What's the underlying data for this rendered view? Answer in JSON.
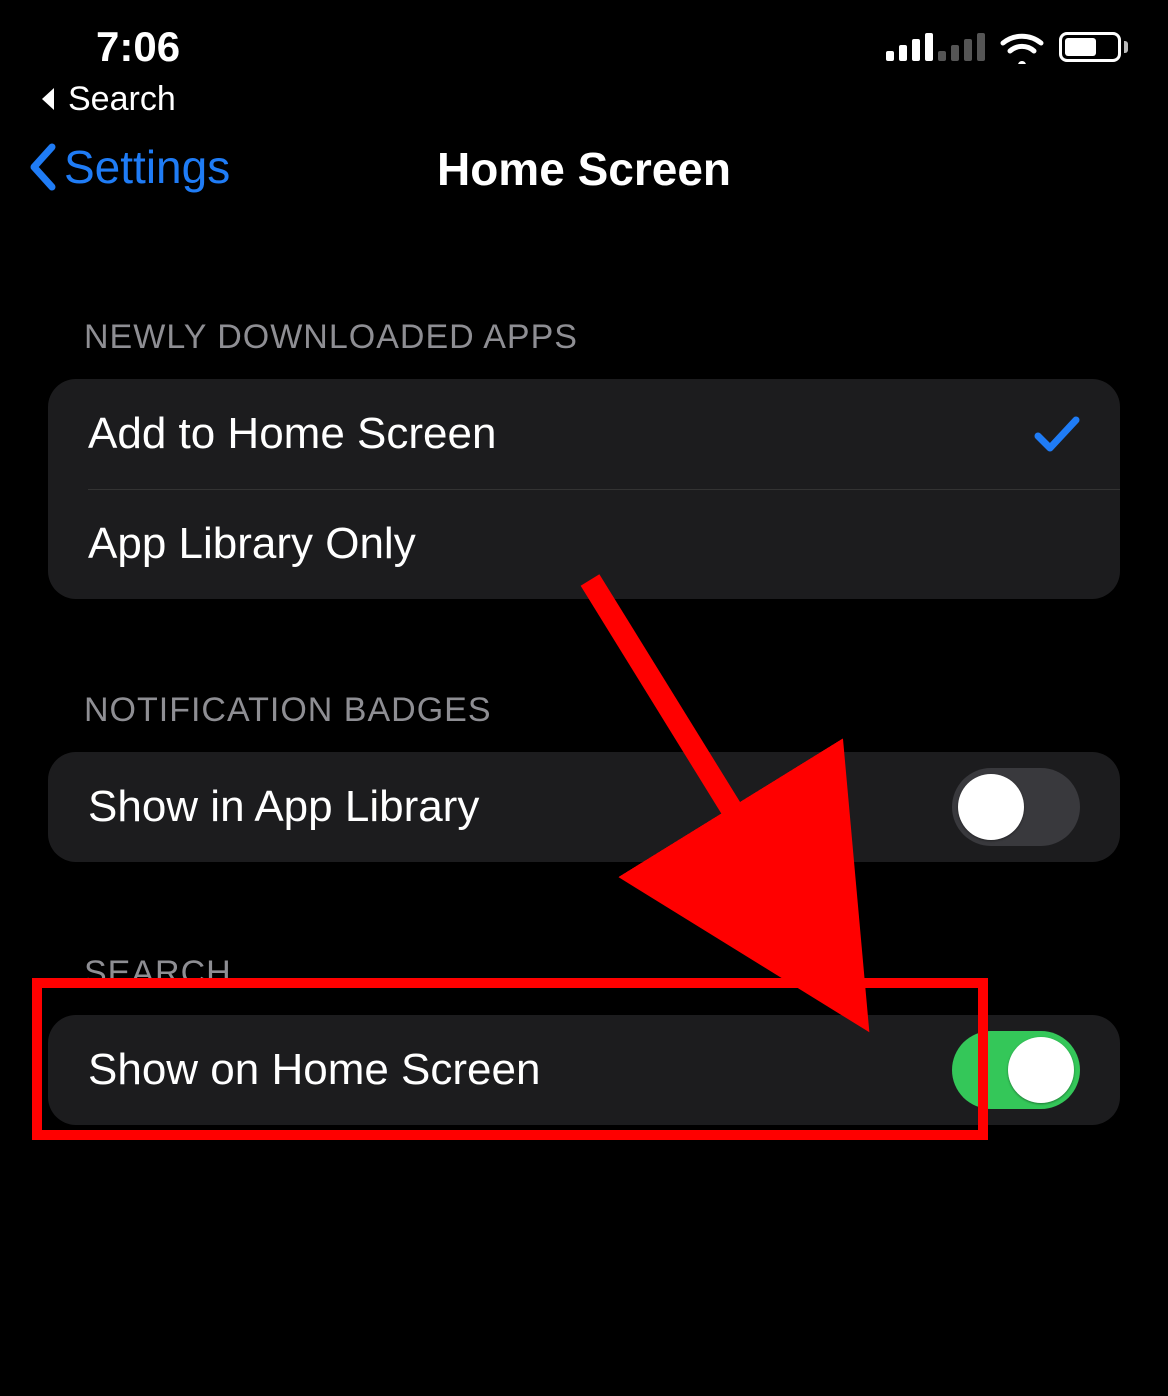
{
  "status_bar": {
    "time": "7:06"
  },
  "breadcrumb": {
    "back_app": "Search"
  },
  "nav": {
    "back_label": "Settings",
    "title": "Home Screen"
  },
  "sections": {
    "newly_downloaded": {
      "header": "NEWLY DOWNLOADED APPS",
      "options": {
        "add_home": "Add to Home Screen",
        "app_library_only": "App Library Only",
        "selected": "add_home"
      }
    },
    "notification_badges": {
      "header": "NOTIFICATION BADGES",
      "show_in_app_library": {
        "label": "Show in App Library",
        "enabled": false
      }
    },
    "search": {
      "header": "SEARCH",
      "show_on_home_screen": {
        "label": "Show on Home Screen",
        "enabled": true
      }
    }
  }
}
